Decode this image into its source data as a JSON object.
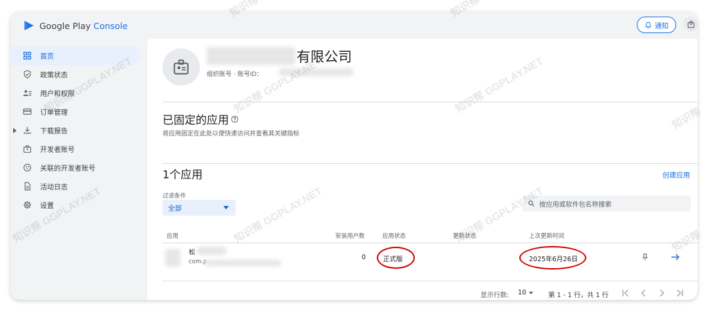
{
  "app": {
    "name_prefix": "Google Play ",
    "name_suffix": "Console"
  },
  "header": {
    "notify_label": "通知"
  },
  "sidebar": {
    "items": [
      {
        "label": "首页",
        "icon": "dashboard-icon",
        "active": true
      },
      {
        "label": "政策状态",
        "icon": "shield-icon"
      },
      {
        "label": "用户和权限",
        "icon": "people-icon"
      },
      {
        "label": "订单管理",
        "icon": "credit-card-icon"
      },
      {
        "label": "下载报告",
        "icon": "download-icon"
      },
      {
        "label": "开发者账号",
        "icon": "badge-icon"
      },
      {
        "label": "关联的开发者账号",
        "icon": "linked-accounts-icon"
      },
      {
        "label": "活动日志",
        "icon": "document-icon"
      },
      {
        "label": "设置",
        "icon": "gear-icon"
      }
    ]
  },
  "org": {
    "name": "有限公司",
    "meta": "组织账号 · 账号ID："
  },
  "pinned": {
    "title": "已固定的应用",
    "subtitle": "将应用固定在此处以便快速访问并查看其关键指标"
  },
  "apps": {
    "title": "1个应用",
    "create_label": "创建应用",
    "filter_label": "过滤条件",
    "filter_value": "全部",
    "search_placeholder": "按应用或软件包名称搜索",
    "columns": [
      "应用",
      "安装用户数",
      "应用状态",
      "更新状态",
      "上次更新时间"
    ],
    "rows": [
      {
        "name": "松",
        "package": "com.p",
        "installs": "0",
        "status": "正式版",
        "update_status": "",
        "last_updated": "2025年6月26日"
      }
    ],
    "rows_per_page_label": "显示行数:",
    "rows_per_page": "10",
    "range": "第 1 - 1 行，共 1 行"
  },
  "watermarks": [
    "知识帮 GGPLAY.NET",
    "知识帮 GGPLAY.NET",
    "知识帮 GGPLAY.NET",
    "知识帮 GGPLAY.NET",
    "知识帮 GGPLAY.NET",
    "知识帮 GGPLAY.NET",
    "知识帮",
    "知识帮",
    "知识帮",
    "知识帮"
  ],
  "colors": {
    "accent": "#1a73e8",
    "active_bg": "#e8f0fe",
    "highlight": "#d50000",
    "frame": "#f1f3f4"
  }
}
